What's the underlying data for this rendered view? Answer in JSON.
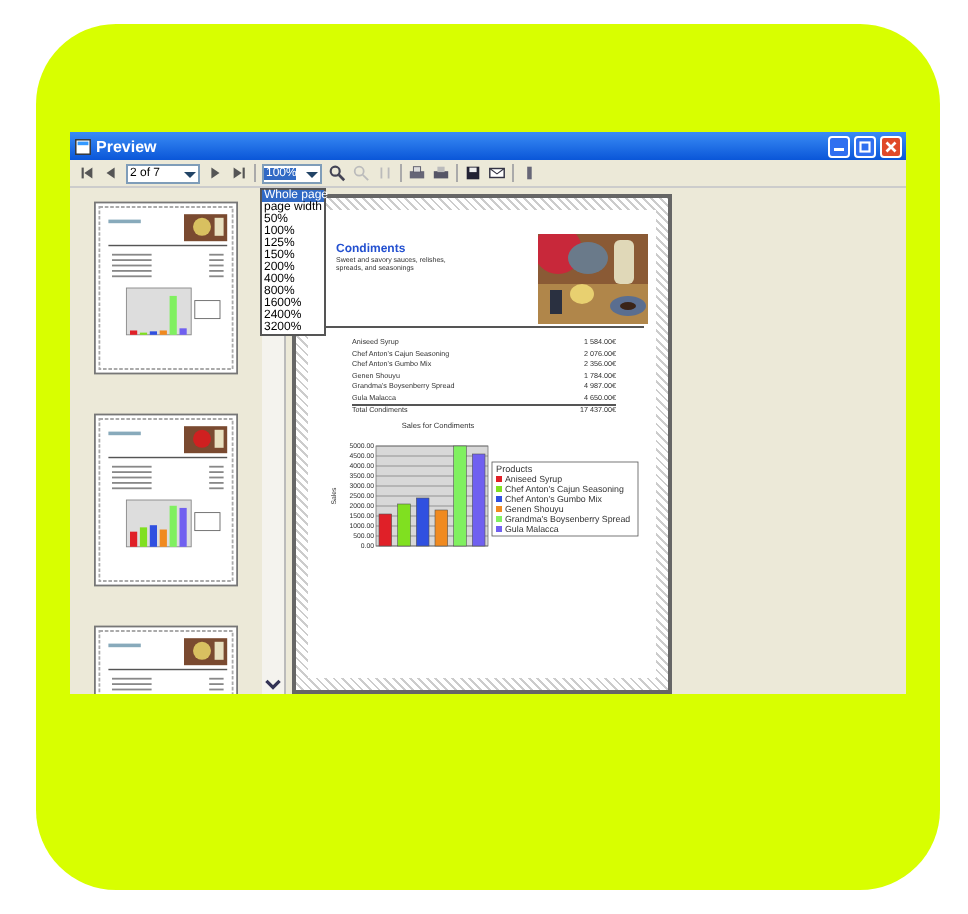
{
  "window": {
    "title": "Preview"
  },
  "toolbar": {
    "page_field": "2 of 7",
    "zoom_field": "100%"
  },
  "zoom_menu": [
    {
      "label": "Whole page",
      "selected": true
    },
    {
      "label": "page width",
      "selected": false
    },
    {
      "label": "50%",
      "selected": false
    },
    {
      "label": "100%",
      "selected": false
    },
    {
      "label": "125%",
      "selected": false
    },
    {
      "label": "150%",
      "selected": false
    },
    {
      "label": "200%",
      "selected": false
    },
    {
      "label": "400%",
      "selected": false
    },
    {
      "label": "800%",
      "selected": false
    },
    {
      "label": "1600%",
      "selected": false
    },
    {
      "label": "2400%",
      "selected": false
    },
    {
      "label": "3200%",
      "selected": false
    }
  ],
  "page": {
    "heading": "Condiments",
    "description": "Sweet and savory sauces, relishes, spreads, and seasonings",
    "rows": [
      {
        "product": "Aniseed Syrup",
        "amount": "1 584.00€"
      },
      {
        "product": "Chef Anton's Cajun Seasoning",
        "amount": "2 076.00€"
      },
      {
        "product": "Chef Anton's Gumbo Mix",
        "amount": "2 356.00€"
      },
      {
        "product": "Genen Shouyu",
        "amount": "1 784.00€"
      },
      {
        "product": "Grandma's Boysenberry Spread",
        "amount": "4 987.00€"
      },
      {
        "product": "Gula Malacca",
        "amount": "4 650.00€"
      }
    ],
    "total": {
      "label": "Total Condiments",
      "amount": "17 437.00€"
    },
    "chart_data": {
      "type": "bar",
      "title": "Sales for Condiments",
      "ylabel": "Sales",
      "legend": {
        "title": "Products"
      },
      "series": [
        {
          "name": "Aniseed Syrup",
          "color": "#e02028",
          "values": [
            1600
          ]
        },
        {
          "name": "Chef Anton's Cajun Seasoning",
          "color": "#80e020",
          "values": [
            2100
          ]
        },
        {
          "name": "Chef Anton's Gumbo Mix",
          "color": "#3050e0",
          "values": [
            2400
          ]
        },
        {
          "name": "Genen Shouyu",
          "color": "#f08a20",
          "values": [
            1800
          ]
        },
        {
          "name": "Grandma's Boysenberry Spread",
          "color": "#80f060",
          "values": [
            5000
          ]
        },
        {
          "name": "Gula Malacca",
          "color": "#7060f0",
          "values": [
            4600
          ]
        }
      ],
      "grid": true,
      "ylim": [
        0,
        5000
      ],
      "yticks": [
        {
          "value": 0,
          "label": "0.00"
        },
        {
          "value": 500,
          "label": "500.00"
        },
        {
          "value": 1000,
          "label": "1000.00"
        },
        {
          "value": 1500,
          "label": "1500.00"
        },
        {
          "value": 2000,
          "label": "2000.00"
        },
        {
          "value": 2500,
          "label": "2500.00"
        },
        {
          "value": 3000,
          "label": "3000.00"
        },
        {
          "value": 3500,
          "label": "3500.00"
        },
        {
          "value": 4000,
          "label": "4000.00"
        },
        {
          "value": 4500,
          "label": "4500.00"
        },
        {
          "value": 5000,
          "label": "5000.00"
        }
      ]
    }
  }
}
